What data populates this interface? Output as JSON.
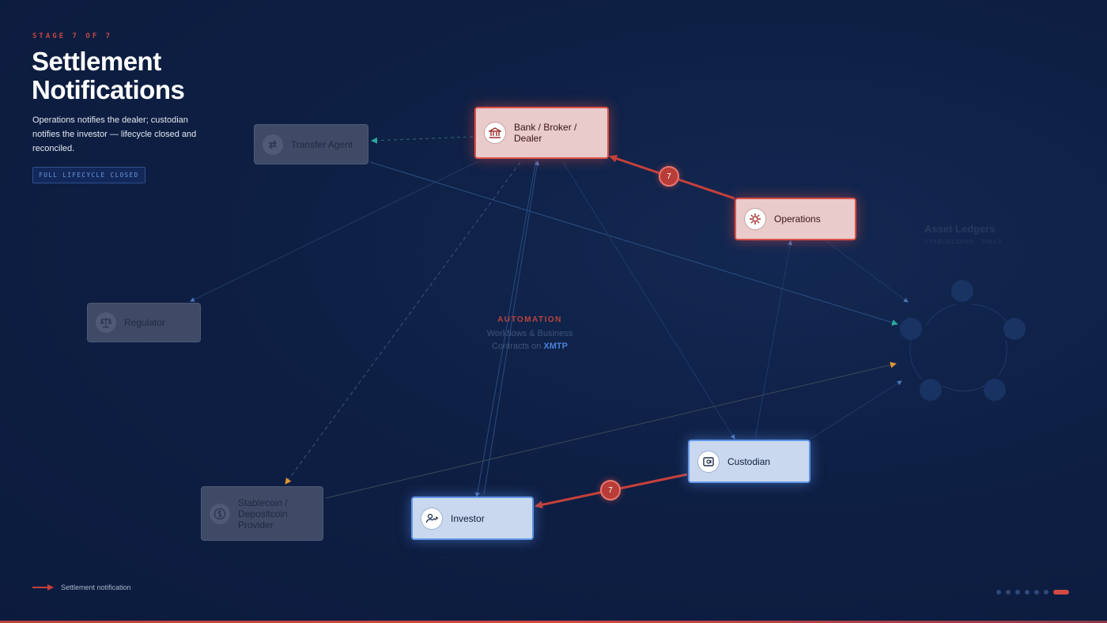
{
  "header": {
    "stage_label": "STAGE 7 OF 7",
    "title": "Settlement Notifications",
    "subtitle": "Operations notifies the dealer; custodian notifies the investor — lifecycle closed and reconciled.",
    "badge": "FULL LIFECYCLE CLOSED"
  },
  "nodes": {
    "transfer_agent": {
      "label": "Transfer Agent",
      "icon": "swap-arrows-icon"
    },
    "bank": {
      "label": "Bank / Broker / Dealer",
      "icon": "bank-icon"
    },
    "operations": {
      "label": "Operations",
      "icon": "gear-icon"
    },
    "regulator": {
      "label": "Regulator",
      "icon": "scales-icon"
    },
    "custodian": {
      "label": "Custodian",
      "icon": "safe-icon"
    },
    "stablecoin": {
      "label": "Stablecoin / Depositcoin Provider",
      "icon": "dollar-coin-icon"
    },
    "investor": {
      "label": "Investor",
      "icon": "investor-icon"
    }
  },
  "steps": {
    "ops_to_bank": "7",
    "custodian_to_investor": "7"
  },
  "center": {
    "kicker": "AUTOMATION",
    "line1": "Workflows & Business",
    "line2_prefix": "Contracts on ",
    "line2_highlight": "XMTP"
  },
  "ledgers": {
    "title": "Asset Ledgers",
    "subtitle": "STABLECOINS · RWAS"
  },
  "legend": {
    "label": "Settlement notification"
  },
  "pager": {
    "total": 7,
    "active": 7
  },
  "colors": {
    "background": "#0c1b3d",
    "accent_red": "#d14a43",
    "accent_blue": "#5f95e6",
    "active_node_red": "#e9cbcb",
    "active_node_blue": "#c9d8ee",
    "inactive_node": "#3f4a66",
    "teal_arrow": "#2aa89a",
    "orange_arrow": "#e0962f"
  }
}
